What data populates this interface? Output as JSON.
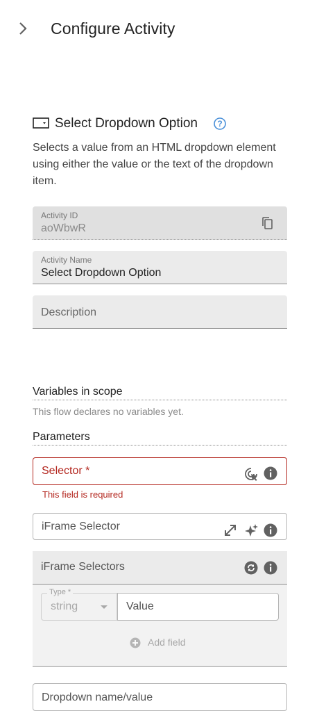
{
  "header": {
    "title": "Configure Activity",
    "collapse_icon": "chevron-right-icon"
  },
  "activity": {
    "icon": "dropdown-box-icon",
    "title": "Select Dropdown Option",
    "help_icon": "help-circle-icon",
    "description": "Selects a value from an HTML dropdown element using either the value or the text of the dropdown item."
  },
  "fields": {
    "activity_id": {
      "label": "Activity ID",
      "value": "aoWbwR",
      "icon": "copy-icon"
    },
    "activity_name": {
      "label": "Activity Name",
      "value": "Select Dropdown Option"
    },
    "description": {
      "placeholder": "Description"
    }
  },
  "variables": {
    "heading": "Variables in scope",
    "hint": "This flow declares no variables yet."
  },
  "parameters": {
    "heading": "Parameters",
    "selector": {
      "label": "Selector *",
      "error": "This field is required",
      "icons": [
        "pick-target-icon",
        "info-icon"
      ]
    },
    "iframe_selector": {
      "label": "iFrame Selector",
      "icons": [
        "expand-icon",
        "sparkle-icon",
        "info-icon"
      ]
    },
    "iframe_selectors": {
      "label": "iFrame Selectors",
      "icons": [
        "refresh-icon",
        "info-icon"
      ],
      "type_label": "Type *",
      "type_value": "string",
      "value_placeholder": "Value",
      "add_field": "Add field"
    },
    "dropdown_field": {
      "label": "Dropdown name/value"
    }
  },
  "colors": {
    "error": "#b3261e",
    "accent": "#4a90d9",
    "icon": "#616161"
  }
}
